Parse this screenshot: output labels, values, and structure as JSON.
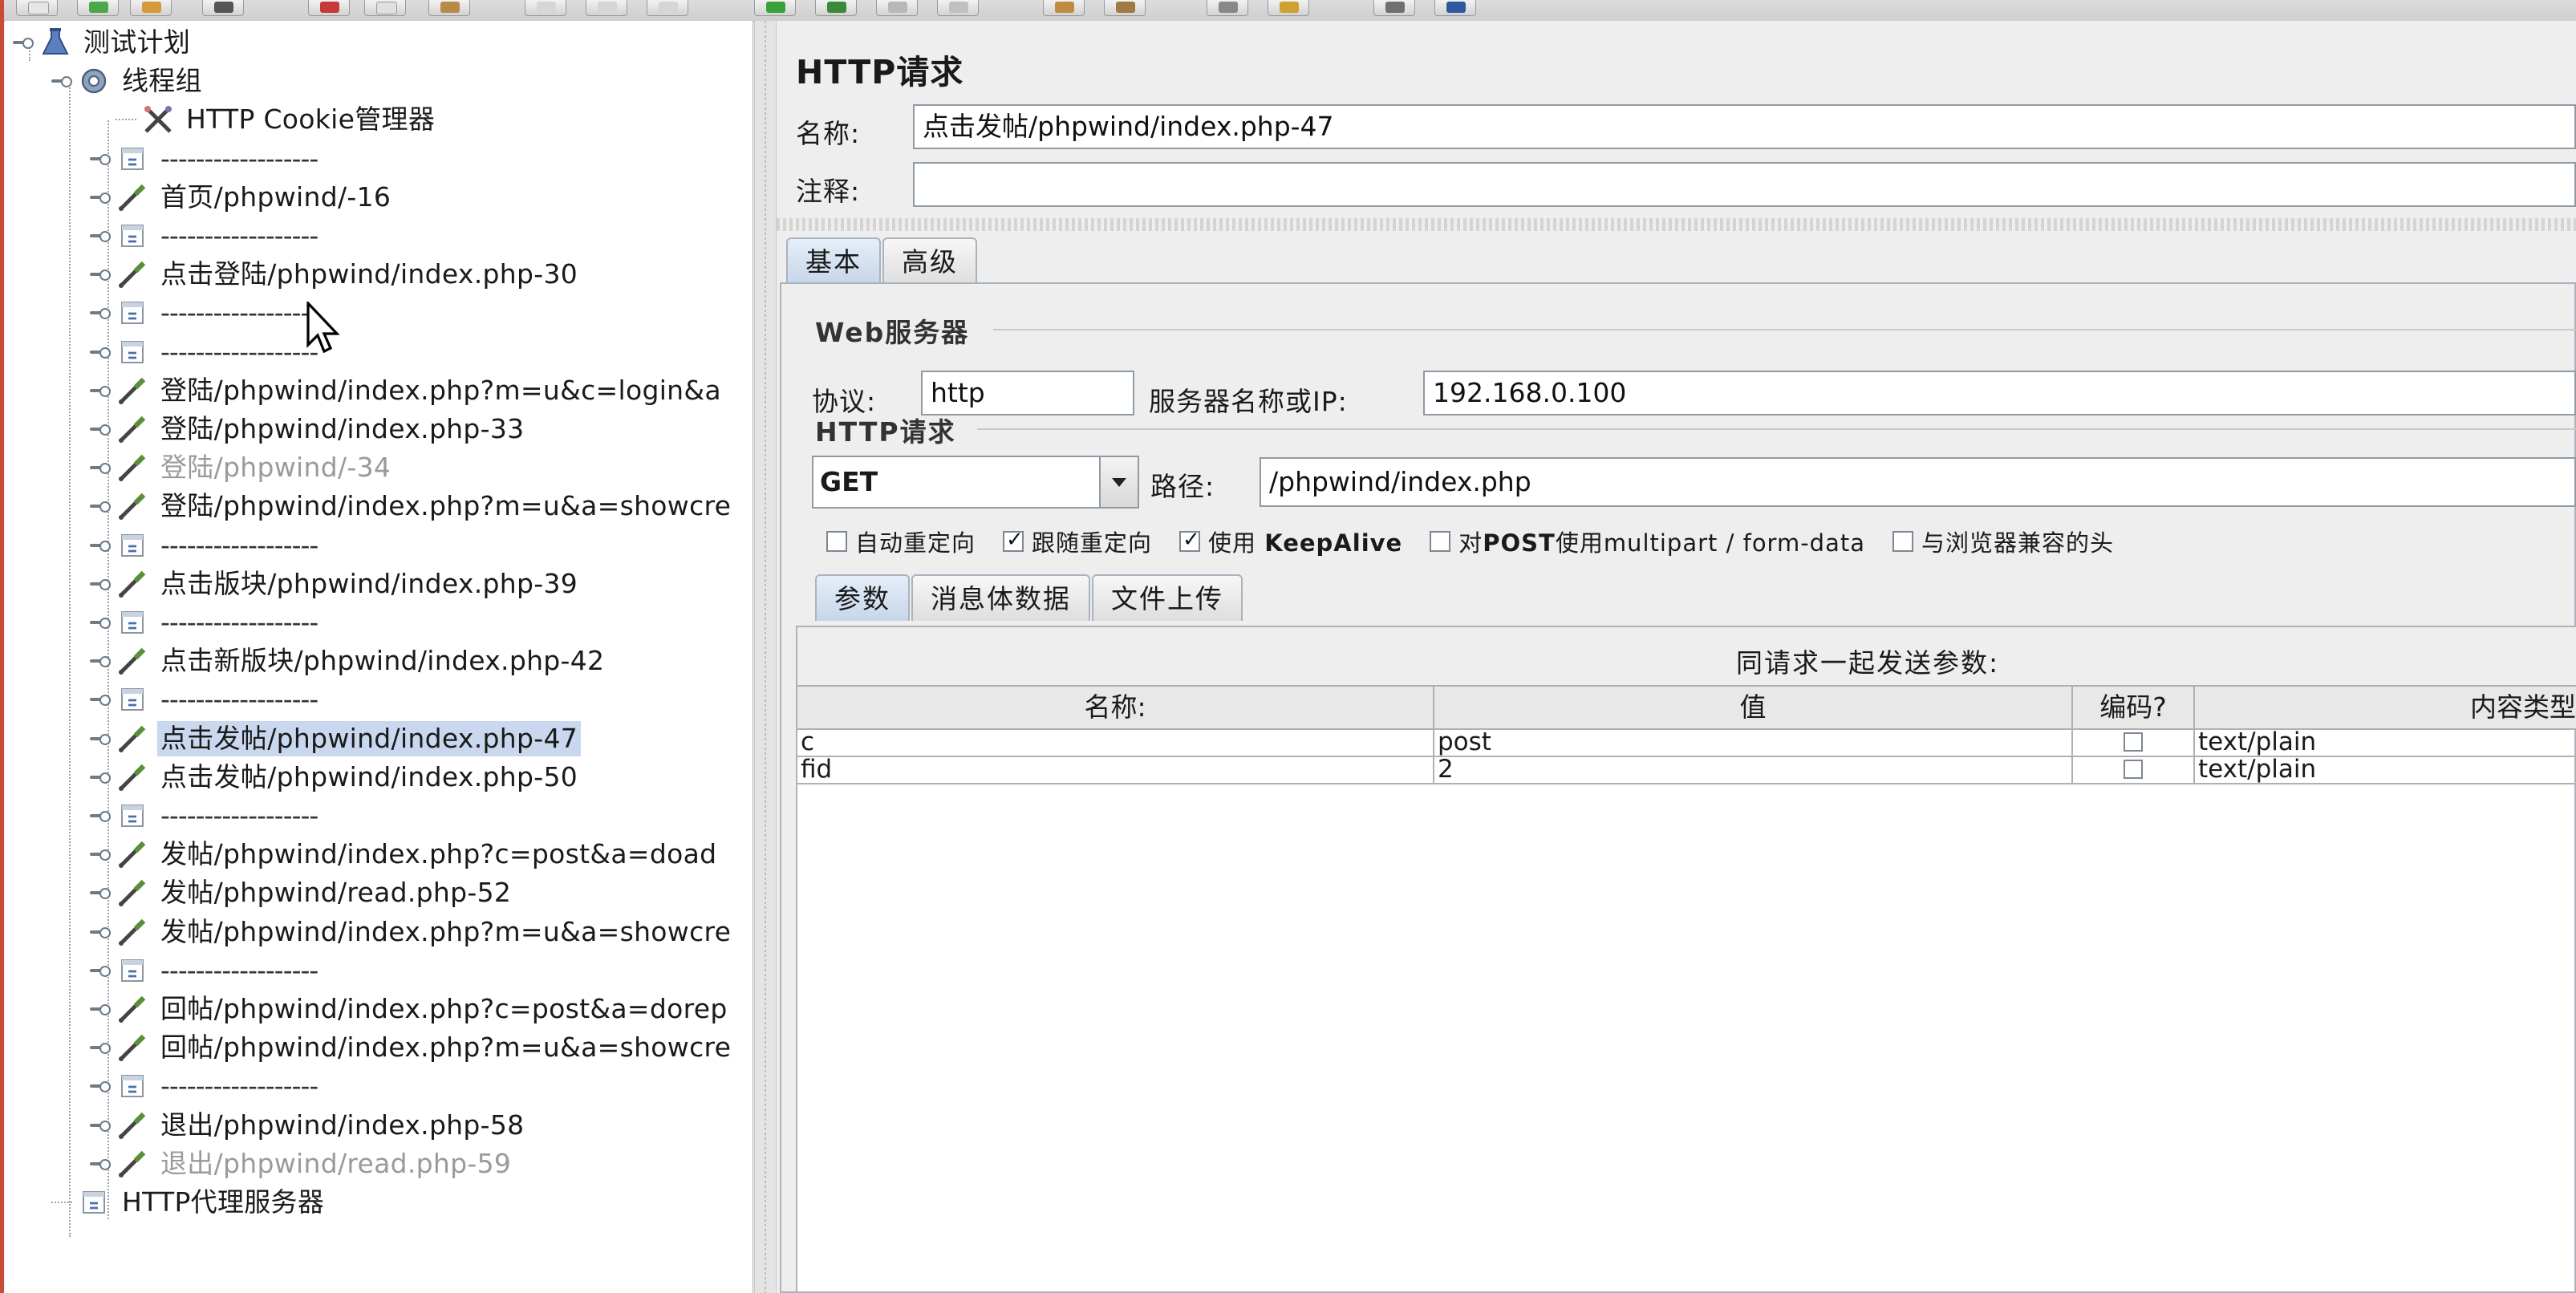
{
  "colors": {
    "selection": "#c9d8ee",
    "tab_active": "#c6d6ea",
    "panel_bg": "#eeeeee",
    "dim_text": "#9a9a9a"
  },
  "tree": {
    "items": [
      {
        "label": "测试计划",
        "icon": "test-plan-flask-icon",
        "level": 0,
        "expandable": true
      },
      {
        "label": "线程组",
        "icon": "thread-group-gear-icon",
        "level": 1,
        "expandable": true
      },
      {
        "label": "HTTP Cookie管理器",
        "icon": "config-tools-icon",
        "level": 2,
        "expandable": false
      },
      {
        "label": "------------------",
        "icon": "simple-controller-icon",
        "level": 2,
        "expandable": true,
        "separator": true
      },
      {
        "label": "首页/phpwind/-16",
        "icon": "sampler-pipette-icon",
        "level": 2,
        "expandable": true
      },
      {
        "label": "------------------",
        "icon": "simple-controller-icon",
        "level": 2,
        "expandable": true,
        "separator": true
      },
      {
        "label": "点击登陆/phpwind/index.php-30",
        "icon": "sampler-pipette-icon",
        "level": 2,
        "expandable": true
      },
      {
        "label": "------------------",
        "icon": "simple-controller-icon",
        "level": 2,
        "expandable": true,
        "separator": true
      },
      {
        "label": "------------------",
        "icon": "simple-controller-icon",
        "level": 2,
        "expandable": true,
        "separator": true
      },
      {
        "label": "登陆/phpwind/index.php?m=u&c=login&a",
        "icon": "sampler-pipette-icon",
        "level": 2,
        "expandable": true
      },
      {
        "label": "登陆/phpwind/index.php-33",
        "icon": "sampler-pipette-icon",
        "level": 2,
        "expandable": true
      },
      {
        "label": "登陆/phpwind/-34",
        "icon": "sampler-pipette-icon",
        "level": 2,
        "expandable": true,
        "disabled": true
      },
      {
        "label": "登陆/phpwind/index.php?m=u&a=showcre",
        "icon": "sampler-pipette-icon",
        "level": 2,
        "expandable": true
      },
      {
        "label": "------------------",
        "icon": "simple-controller-icon",
        "level": 2,
        "expandable": true,
        "separator": true
      },
      {
        "label": "点击版块/phpwind/index.php-39",
        "icon": "sampler-pipette-icon",
        "level": 2,
        "expandable": true
      },
      {
        "label": "------------------",
        "icon": "simple-controller-icon",
        "level": 2,
        "expandable": true,
        "separator": true
      },
      {
        "label": "点击新版块/phpwind/index.php-42",
        "icon": "sampler-pipette-icon",
        "level": 2,
        "expandable": true
      },
      {
        "label": "------------------",
        "icon": "simple-controller-icon",
        "level": 2,
        "expandable": true,
        "separator": true
      },
      {
        "label": "点击发帖/phpwind/index.php-47",
        "icon": "sampler-pipette-icon",
        "level": 2,
        "expandable": true,
        "selected": true
      },
      {
        "label": "点击发帖/phpwind/index.php-50",
        "icon": "sampler-pipette-icon",
        "level": 2,
        "expandable": true
      },
      {
        "label": "------------------",
        "icon": "simple-controller-icon",
        "level": 2,
        "expandable": true,
        "separator": true
      },
      {
        "label": "发帖/phpwind/index.php?c=post&a=doad",
        "icon": "sampler-pipette-icon",
        "level": 2,
        "expandable": true
      },
      {
        "label": "发帖/phpwind/read.php-52",
        "icon": "sampler-pipette-icon",
        "level": 2,
        "expandable": true
      },
      {
        "label": "发帖/phpwind/index.php?m=u&a=showcre",
        "icon": "sampler-pipette-icon",
        "level": 2,
        "expandable": true
      },
      {
        "label": "------------------",
        "icon": "simple-controller-icon",
        "level": 2,
        "expandable": true,
        "separator": true
      },
      {
        "label": "回帖/phpwind/index.php?c=post&a=dorep",
        "icon": "sampler-pipette-icon",
        "level": 2,
        "expandable": true
      },
      {
        "label": "回帖/phpwind/index.php?m=u&a=showcre",
        "icon": "sampler-pipette-icon",
        "level": 2,
        "expandable": true
      },
      {
        "label": "------------------",
        "icon": "simple-controller-icon",
        "level": 2,
        "expandable": true,
        "separator": true
      },
      {
        "label": "退出/phpwind/index.php-58",
        "icon": "sampler-pipette-icon",
        "level": 2,
        "expandable": true
      },
      {
        "label": "退出/phpwind/read.php-59",
        "icon": "sampler-pipette-icon",
        "level": 2,
        "expandable": true,
        "disabled": true
      },
      {
        "label": "HTTP代理服务器",
        "icon": "proxy-server-icon",
        "level": 1,
        "expandable": false
      }
    ]
  },
  "editor": {
    "title": "HTTP请求",
    "name_label": "名称:",
    "name_value": "点击发帖/phpwind/index.php-47",
    "comment_label": "注释:",
    "comment_value": "",
    "tabs": [
      "基本",
      "高级"
    ],
    "web_server_group": "Web服务器",
    "protocol_label": "协议:",
    "protocol_value": "http",
    "server_label": "服务器名称或IP:",
    "server_value": "192.168.0.100",
    "http_request_group": "HTTP请求",
    "method_value": "GET",
    "path_label": "路径:",
    "path_value": "/phpwind/index.php",
    "options": [
      {
        "label_prefix": "",
        "label_bold": "",
        "label": "自动重定向",
        "checked": false
      },
      {
        "label_prefix": "",
        "label_bold": "",
        "label": "跟随重定向",
        "checked": true
      },
      {
        "label_prefix": "使用 ",
        "label_bold": "KeepAlive",
        "label": "",
        "checked": true
      },
      {
        "label_prefix": "对",
        "label_bold": "POST",
        "label": "使用multipart / form-data",
        "checked": false
      },
      {
        "label_prefix": "",
        "label_bold": "",
        "label": "与浏览器兼容的头",
        "checked": false
      }
    ],
    "param_tabs": [
      "参数",
      "消息体数据",
      "文件上传"
    ],
    "params_caption": "同请求一起发送参数:",
    "columns": [
      "名称:",
      "值",
      "编码?",
      "内容类型"
    ],
    "rows": [
      {
        "name": "c",
        "value": "post",
        "encode": false,
        "content_type": "text/plain"
      },
      {
        "name": "fid",
        "value": "2",
        "encode": false,
        "content_type": "text/plain"
      }
    ]
  }
}
